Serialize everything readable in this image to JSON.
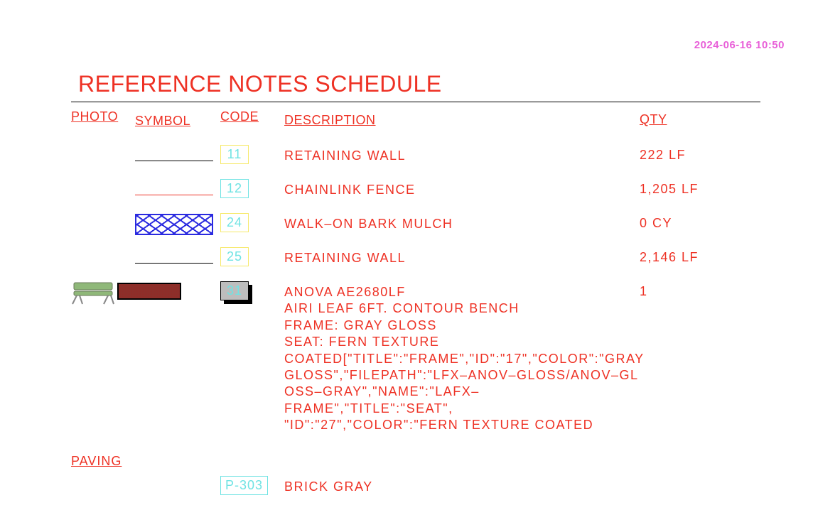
{
  "timestamp": "2024-06-16 10:50",
  "title": "REFERENCE NOTES SCHEDULE",
  "headers": {
    "photo": "PHOTO",
    "symbol": "SYMBOL",
    "code": "CODE",
    "description": "DESCRIPTION",
    "qty": "QTY"
  },
  "rows": [
    {
      "code": "11",
      "description": "RETAINING  WALL",
      "qty": "222  LF"
    },
    {
      "code": "12",
      "description": "CHAINLINK  FENCE",
      "qty": "1,205  LF"
    },
    {
      "code": "24",
      "description": "WALK–ON  BARK  MULCH",
      "qty": "0  CY"
    },
    {
      "code": "25",
      "description": "RETAINING  WALL",
      "qty": "2,146  LF"
    },
    {
      "code": "31",
      "description": "ANOVA  AE2680LF\nAIRI  LEAF  6FT.  CONTOUR  BENCH\nFRAME:  GRAY  GLOSS\nSEAT:  FERN  TEXTURE\nCOATED[\"TITLE\":\"FRAME\",\"ID\":\"17\",\"COLOR\":\"GRAY\nGLOSS\",\"FILEPATH\":\"LFX–ANOV–GLOSS/ANOV–GL\nOSS–GRAY\",\"NAME\":\"LAFX–FRAME\",\"TITLE\":\"SEAT\",\n\"ID\":\"27\",\"COLOR\":\"FERN  TEXTURE  COATED",
      "qty": "1"
    }
  ],
  "sections": {
    "paving": {
      "label": "PAVING",
      "rows": [
        {
          "code": "P-303",
          "description": "BRICK  GRAY",
          "qty": ""
        }
      ]
    }
  }
}
